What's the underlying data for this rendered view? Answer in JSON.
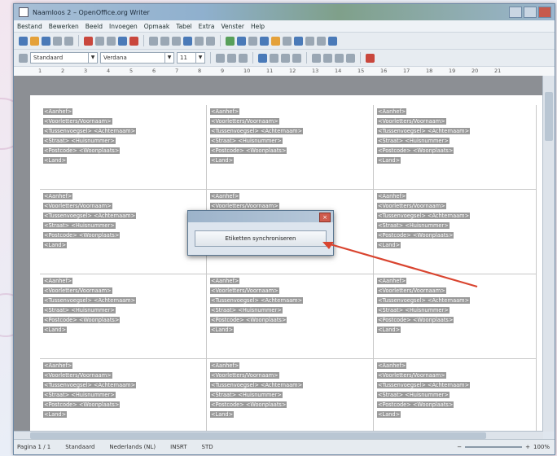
{
  "window": {
    "title": "Naamloos 2 – OpenOffice.org Writer"
  },
  "menu": [
    "Bestand",
    "Bewerken",
    "Beeld",
    "Invoegen",
    "Opmaak",
    "Tabel",
    "Extra",
    "Venster",
    "Help"
  ],
  "format_bar": {
    "style": "Standaard",
    "font": "Verdana",
    "size": "11"
  },
  "ruler": [
    "1",
    "2",
    "3",
    "4",
    "5",
    "6",
    "7",
    "8",
    "9",
    "10",
    "11",
    "12",
    "13",
    "14",
    "15",
    "16",
    "17",
    "18",
    "19",
    "20",
    "21"
  ],
  "label_fields": [
    "<Aanhef>",
    "<Voorletters/Voornaam>",
    "<Tussenvoegsel> <Achternaam>",
    "<Straat> <Huisnummer>",
    "<Postcode> <Woonplaats>",
    "<Land>"
  ],
  "dialog": {
    "button": "Etiketten synchroniseren"
  },
  "status": {
    "page": "Pagina 1 / 1",
    "style": "Standaard",
    "language": "Nederlands (NL)",
    "mode": "INSRT",
    "std": "STD",
    "zoom": "100%"
  },
  "colors": {
    "arrow": "#d9442f",
    "field_bg": "#9a9a9a"
  }
}
